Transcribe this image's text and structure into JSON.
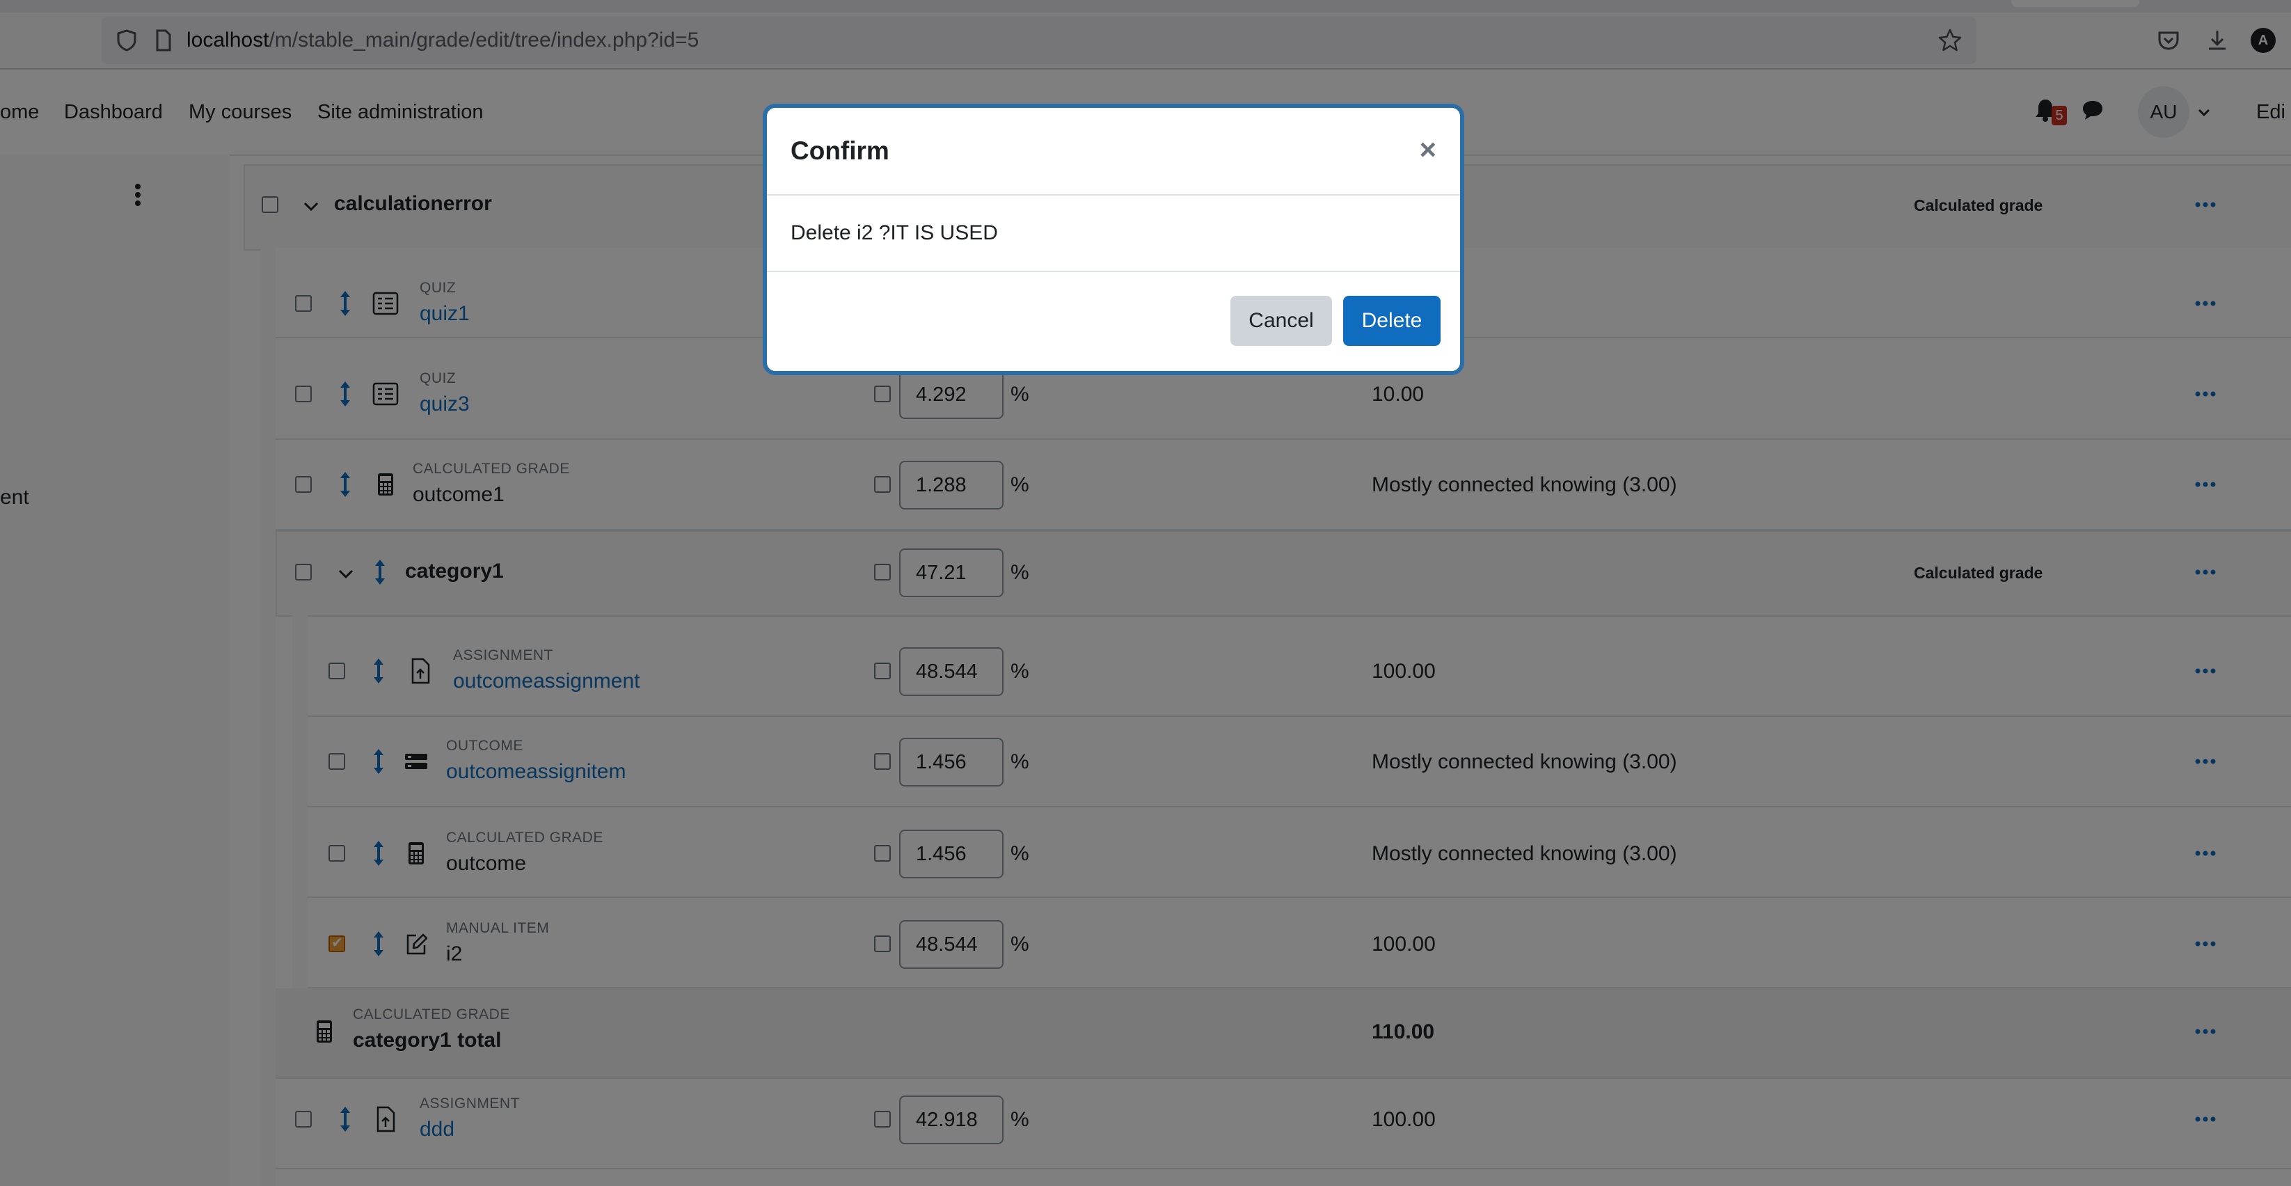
{
  "browser": {
    "url_host": "localhost",
    "url_path": "/m/stable_main/grade/edit/tree/index.php?id=5",
    "profile_initial": "A"
  },
  "navbar": {
    "links": [
      "ome",
      "Dashboard",
      "My courses",
      "Site administration"
    ],
    "notification_count": "5",
    "user_initials": "AU",
    "edit_label": "Edi"
  },
  "drawer": {
    "partial_text": "ent"
  },
  "grades": {
    "top_category": {
      "name": "calculationerror",
      "aggregation_label": "Calculated grade"
    },
    "rows": [
      {
        "type": "QUIZ",
        "name": "quiz1",
        "weight": "",
        "max": ""
      },
      {
        "type": "QUIZ",
        "name": "quiz3",
        "weight": "4.292",
        "max": "10.00"
      },
      {
        "type": "CALCULATED GRADE",
        "name": "outcome1",
        "weight": "1.288",
        "max": "Mostly connected knowing (3.00)"
      },
      {
        "type": "",
        "name": "category1",
        "weight": "47.21",
        "max": "",
        "aggregation_label": "Calculated grade"
      },
      {
        "type": "ASSIGNMENT",
        "name": "outcomeassignment",
        "weight": "48.544",
        "max": "100.00"
      },
      {
        "type": "OUTCOME",
        "name": "outcomeassignitem",
        "weight": "1.456",
        "max": "Mostly connected knowing (3.00)"
      },
      {
        "type": "CALCULATED GRADE",
        "name": "outcome",
        "weight": "1.456",
        "max": "Mostly connected knowing (3.00)"
      },
      {
        "type": "MANUAL ITEM",
        "name": "i2",
        "weight": "48.544",
        "max": "100.00"
      },
      {
        "type": "CALCULATED GRADE",
        "name": "category1 total",
        "weight": "",
        "max": "110.00"
      },
      {
        "type": "ASSIGNMENT",
        "name": "ddd",
        "weight": "42.918",
        "max": "100.00"
      }
    ],
    "percent_sign": "%"
  },
  "modal": {
    "title": "Confirm",
    "close_symbol": "×",
    "message": "Delete i2 ?IT IS USED",
    "cancel_label": "Cancel",
    "delete_label": "Delete"
  },
  "colors": {
    "link": "#0f6cbf",
    "primary_button": "#0f6cbf",
    "checkbox_checked": "#f0a03a"
  }
}
